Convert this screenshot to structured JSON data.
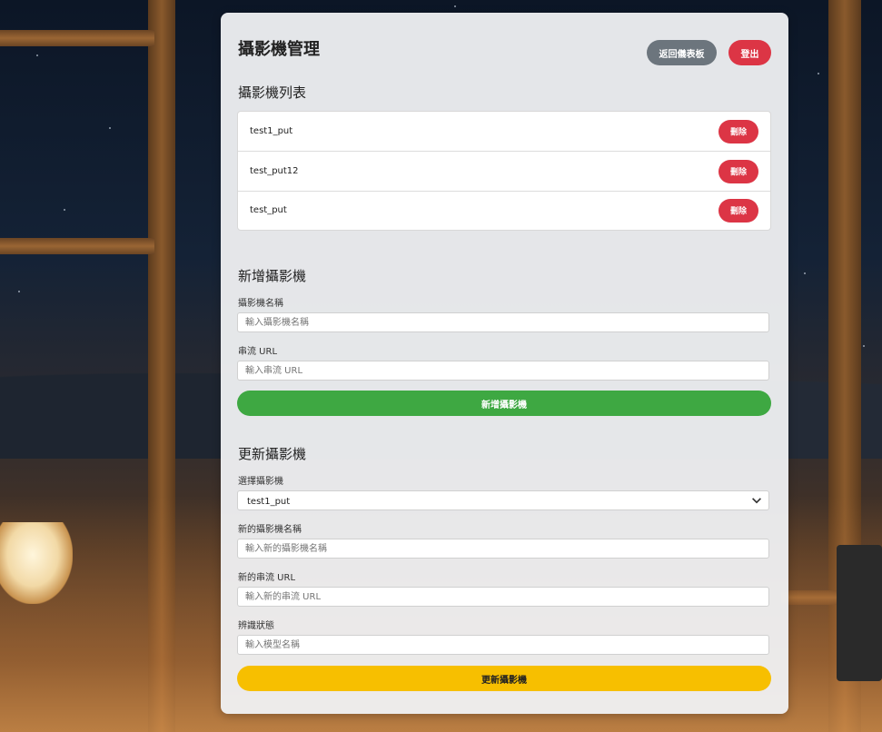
{
  "header": {
    "title": "攝影機管理",
    "back_button": "返回儀表板",
    "logout_button": "登出"
  },
  "camera_list": {
    "heading": "攝影機列表",
    "delete_label": "刪除",
    "items": [
      {
        "name": "test1_put"
      },
      {
        "name": "test_put12"
      },
      {
        "name": "test_put"
      }
    ]
  },
  "add_camera": {
    "heading": "新增攝影機",
    "name_label": "攝影機名稱",
    "name_placeholder": "輸入攝影機名稱",
    "url_label": "串流 URL",
    "url_placeholder": "輸入串流 URL",
    "submit": "新增攝影機"
  },
  "update_camera": {
    "heading": "更新攝影機",
    "select_label": "選擇攝影機",
    "select_value": "test1_put",
    "new_name_label": "新的攝影機名稱",
    "new_name_placeholder": "輸入新的攝影機名稱",
    "new_url_label": "新的串流 URL",
    "new_url_placeholder": "輸入新的串流 URL",
    "status_label": "辨識狀態",
    "status_placeholder": "輸入模型名稱",
    "submit": "更新攝影機"
  },
  "colors": {
    "danger": "#dc3545",
    "secondary": "#6c757d",
    "success": "#3ea842",
    "warning": "#f7bf00"
  }
}
